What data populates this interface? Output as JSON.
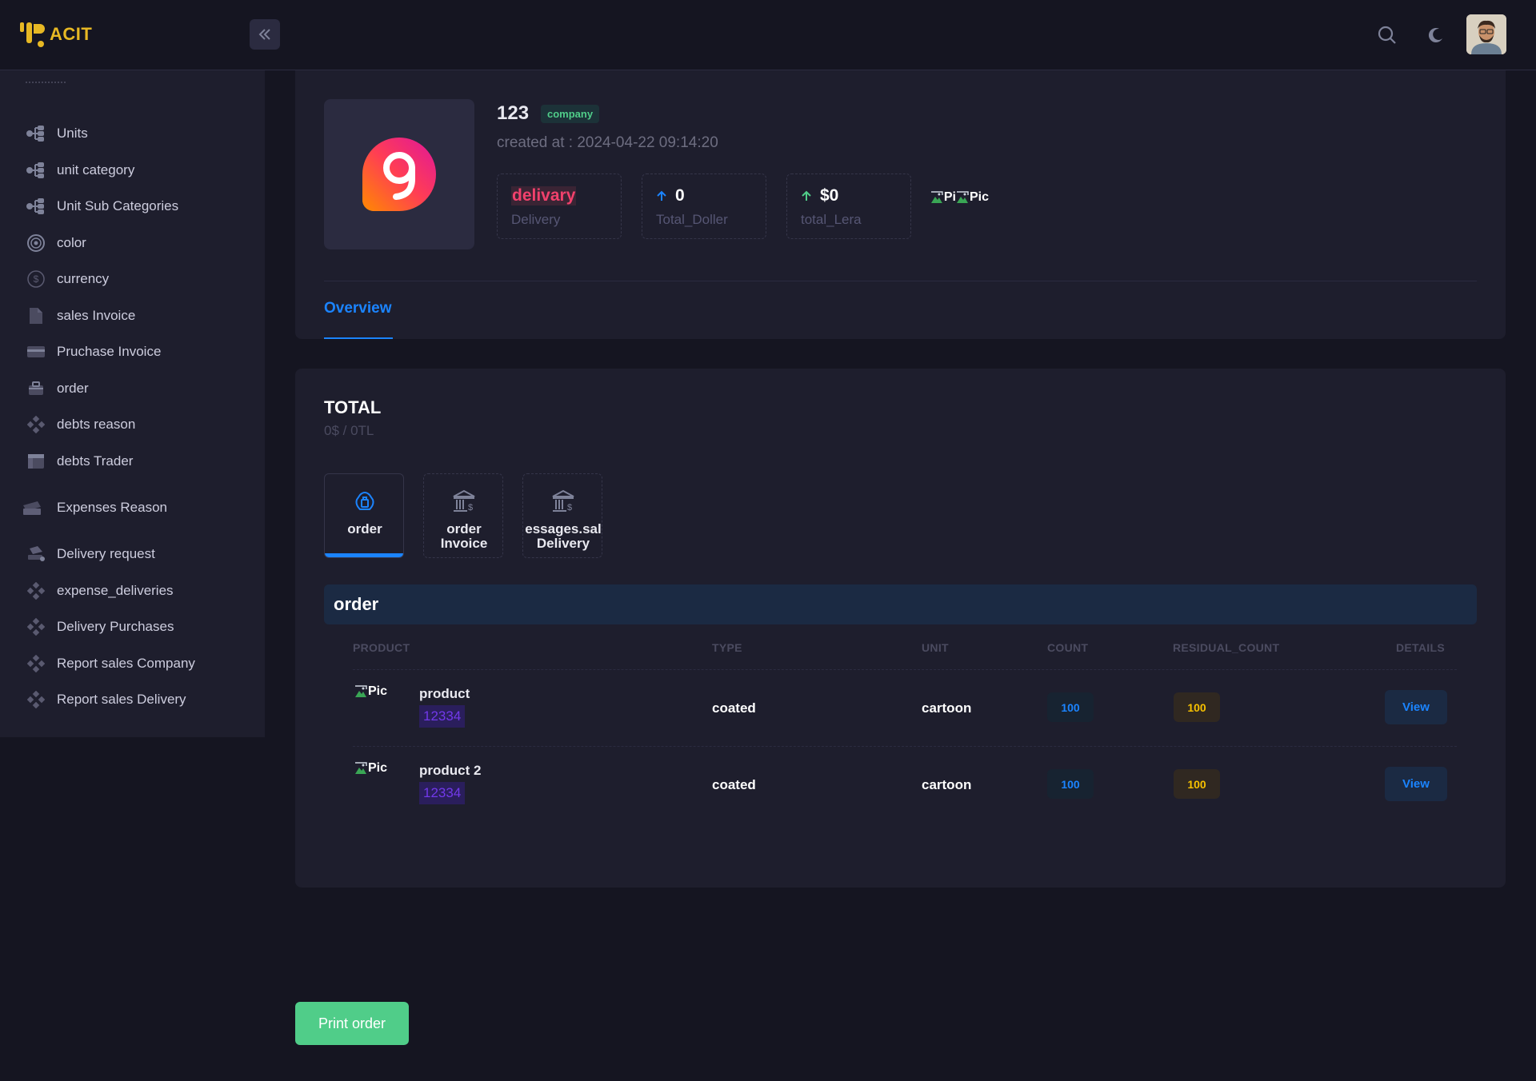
{
  "app": {
    "logo_text": "ACIT"
  },
  "colors": {
    "accent": "#1b84ff",
    "success": "#50cd89",
    "danger": "#f1416c",
    "warning": "#f6c000",
    "logo": "#e7b824"
  },
  "header": {
    "icons": [
      "search-icon",
      "moon-icon"
    ]
  },
  "sidebar": {
    "items": [
      {
        "label": "Units",
        "icon": "hierarchy-icon"
      },
      {
        "label": "unit category",
        "icon": "hierarchy-icon"
      },
      {
        "label": "Unit Sub Categories",
        "icon": "hierarchy-icon"
      },
      {
        "label": "color",
        "icon": "palette-icon"
      },
      {
        "label": "currency",
        "icon": "dollar-circle-icon"
      },
      {
        "label": "sales Invoice",
        "icon": "document-icon"
      },
      {
        "label": "Pruchase Invoice",
        "icon": "card-icon"
      },
      {
        "label": "order",
        "icon": "briefcase-icon"
      },
      {
        "label": "debts reason",
        "icon": "diamond-dots-icon"
      },
      {
        "label": "debts Trader",
        "icon": "table-icon"
      },
      {
        "label": "Expenses Reason",
        "icon": "money-icon"
      },
      {
        "label": "Delivery request",
        "icon": "truck-icon"
      },
      {
        "label": "expense_deliveries",
        "icon": "diamond-dots-icon"
      },
      {
        "label": "Delivery Purchases",
        "icon": "diamond-dots-icon"
      },
      {
        "label": "Report sales Company",
        "icon": "diamond-dots-icon"
      },
      {
        "label": "Report sales Delivery",
        "icon": "diamond-dots-icon"
      }
    ]
  },
  "profile": {
    "name": "123",
    "badge": "company",
    "created_at": "created at : 2024-04-22 09:14:20",
    "stats": [
      {
        "value": "delivary",
        "label": "Delivery"
      },
      {
        "value": "0",
        "label": "Total_Doller"
      },
      {
        "value": "$0",
        "label": "total_Lera"
      }
    ],
    "pics": [
      "Pi",
      "Pic"
    ]
  },
  "tabs": {
    "overview": "Overview"
  },
  "total": {
    "title": "TOTAL",
    "subtitle": "0$ / 0TL"
  },
  "sub_tabs": [
    {
      "label": "order",
      "icon": "box-icon",
      "active": true
    },
    {
      "label": "order Invoice",
      "icon": "bank-icon",
      "active": false
    },
    {
      "label": "essages.sal Delivery",
      "icon": "bank-icon",
      "active": false
    }
  ],
  "section_title": "order",
  "table": {
    "columns": [
      "PRODUCT",
      "TYPE",
      "UNIT",
      "COUNT",
      "RESIDUAL_COUNT",
      "DETAILS"
    ],
    "rows": [
      {
        "pic": "Pic",
        "product": "product",
        "code": "12334",
        "type": "coated",
        "unit": "cartoon",
        "count": "100",
        "residual": "100",
        "action": "View"
      },
      {
        "pic": "Pic",
        "product": "product 2",
        "code": "12334",
        "type": "coated",
        "unit": "cartoon",
        "count": "100",
        "residual": "100",
        "action": "View"
      }
    ]
  },
  "print_button": "Print order"
}
